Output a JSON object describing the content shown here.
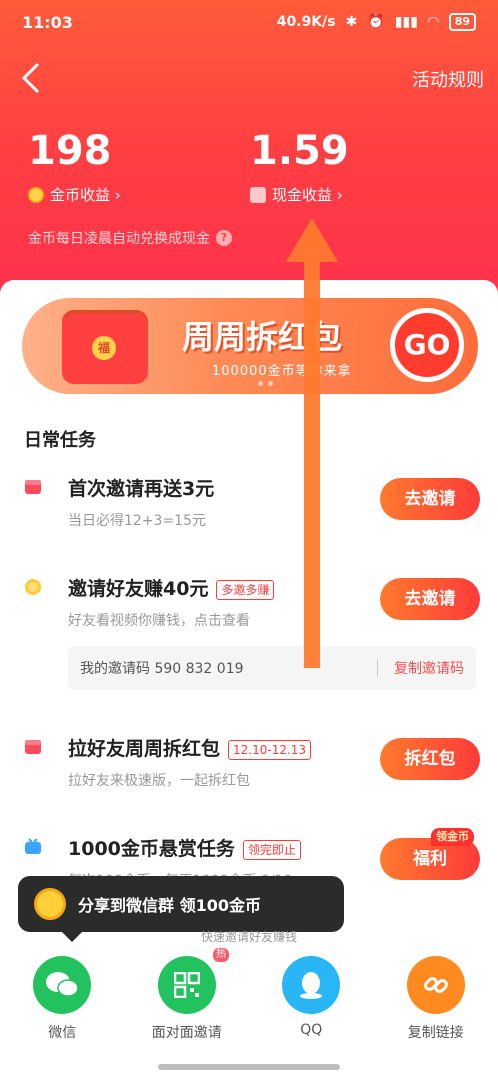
{
  "status_bar": {
    "time": "11:03",
    "speed": "40.9K/s",
    "battery": "89"
  },
  "nav": {
    "rules_label": "活动规则"
  },
  "earnings": {
    "coins_value": "198",
    "coins_label": "金币收益 ›",
    "cash_value": "1.59",
    "cash_label": "现金收益 ›",
    "note": "金币每日凌晨自动兑换成现金",
    "help_icon": "?"
  },
  "banner": {
    "title": "周周拆红包",
    "subtitle": "100000金币等你来拿",
    "go_label": "GO"
  },
  "daily_tasks": {
    "title": "日常任务",
    "tasks": [
      {
        "title": "首次邀请再送3元",
        "desc": "当日必得12+3=15元",
        "button": "去邀请"
      },
      {
        "title": "邀请好友赚40元",
        "tag": "多邀多赚",
        "desc": "好友看视频你赚钱，点击查看",
        "button": "去邀请"
      },
      {
        "title": "拉好友周周拆红包",
        "tag": "12.10-12.13",
        "desc": "拉好友来极速版，一起拆红包",
        "button": "拆红包"
      },
      {
        "title": "1000金币悬赏任务",
        "tag": "领完即止",
        "desc": "每次100金币，每天1000金币 0/10",
        "button": "福利",
        "badge": "领金币"
      }
    ],
    "invite_code_label": "我的邀请码 590 832 019",
    "copy_label": "复制邀请码"
  },
  "toast": {
    "text": "分享到微信群 领100金币"
  },
  "share": {
    "hint": "快速邀请好友赚钱",
    "items": [
      {
        "label": "微信",
        "icon": "wechat-icon",
        "color": "#22c35e"
      },
      {
        "label": "面对面邀请",
        "icon": "qrcode-icon",
        "color": "#22c35e",
        "badge": "热"
      },
      {
        "label": "QQ",
        "icon": "qq-icon",
        "color": "#29b6f6"
      },
      {
        "label": "复制链接",
        "icon": "link-icon",
        "color": "#ff8a1f"
      }
    ]
  },
  "colors": {
    "header_top": "#ff5b3a",
    "header_bottom": "#ff2f4f",
    "button_gradient_start": "#ff7a2e",
    "button_gradient_end": "#ff3a3a",
    "arrow": "#ff7a2e"
  }
}
